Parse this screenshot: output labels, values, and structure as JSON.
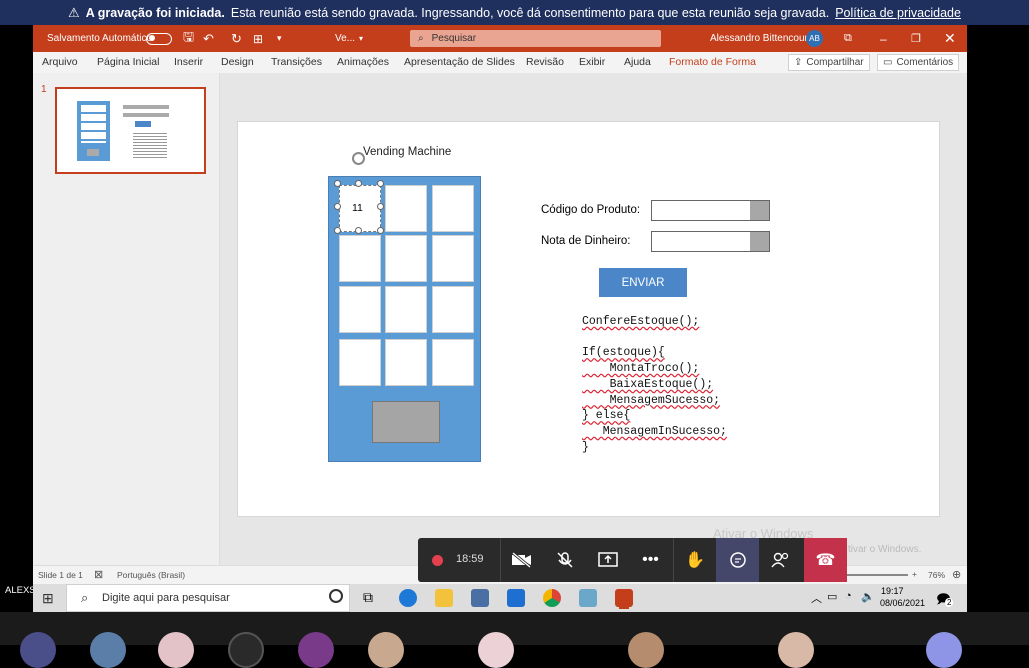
{
  "banner": {
    "title": "A gravação foi iniciada.",
    "message": "Esta reunião está sendo gravada. Ingressando, você dá consentimento para que esta reunião seja gravada.",
    "link": "Política de privacidade"
  },
  "titlebar": {
    "autosave_label": "Salvamento Automático",
    "doc_name": "Ve...",
    "search_placeholder": "Pesquisar",
    "user_name": "Alessandro Bittencourt",
    "user_initials": "AB"
  },
  "ribbon_tabs": [
    "Arquivo",
    "Página Inicial",
    "Inserir",
    "Design",
    "Transições",
    "Animações",
    "Apresentação de Slides",
    "Revisão",
    "Exibir",
    "Ajuda",
    "Formato de Forma"
  ],
  "ribbon_actions": {
    "share": "Compartilhar",
    "comments": "Comentários"
  },
  "thumbnail": {
    "number": "1"
  },
  "slide": {
    "title": "Vending  Machine",
    "selected_cell_label": "11",
    "product_code_label": "Código do Produto:",
    "money_note_label": "Nota de Dinheiro:",
    "send_button": "ENVIAR",
    "code_lines": [
      "ConfereEstoque();",
      "",
      "If(estoque){",
      "    MontaTroco();",
      "    BaixaEstoque();",
      "    MensagemSucesso;",
      "} else{",
      "   MensagemInSucesso;",
      "}"
    ]
  },
  "status": {
    "slide_info": "Slide 1 de 1",
    "language": "Português (Brasil)",
    "zoom": "76%"
  },
  "watermark": {
    "line1": "Ativar o Windows",
    "line2": "tivar o Windows."
  },
  "callbar": {
    "timer": "18:59"
  },
  "presenter_label": "ALEXSANDRO BITTENCOURT",
  "taskbar": {
    "search_placeholder": "Digite aqui para pesquisar",
    "time": "19:17",
    "date": "08/06/2021",
    "notifications": "2"
  },
  "colors": {
    "banner": "#1f2f5e",
    "ppt_accent": "#c43e1c",
    "vending_blue": "#5b9bd5",
    "send_button": "#4a86c8",
    "hangup": "#c4314b"
  }
}
